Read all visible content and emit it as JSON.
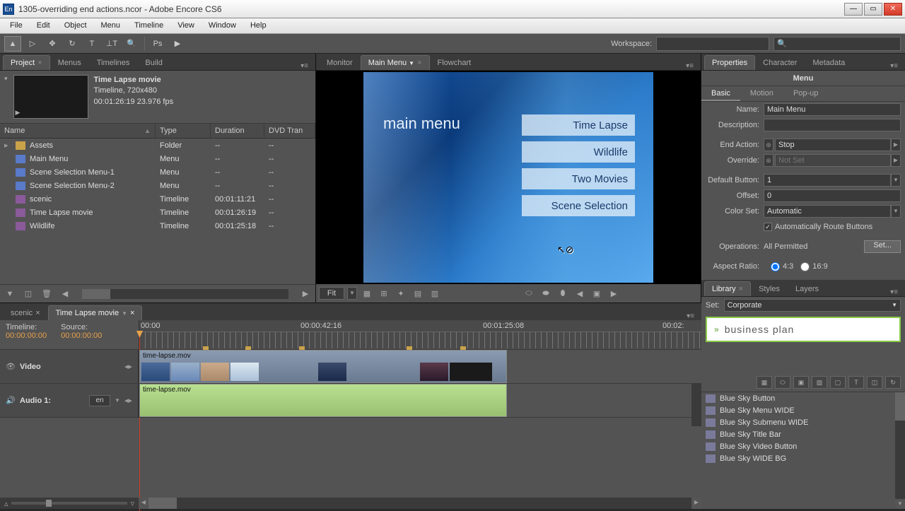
{
  "title": "1305-overriding end actions.ncor - Adobe Encore CS6",
  "menubar": [
    "File",
    "Edit",
    "Object",
    "Menu",
    "Timeline",
    "View",
    "Window",
    "Help"
  ],
  "workspace_label": "Workspace:",
  "project": {
    "tabs": [
      "Project",
      "Menus",
      "Timelines",
      "Build"
    ],
    "active_tab": 0,
    "info": {
      "name": "Time Lapse movie",
      "meta1": "Timeline, 720x480",
      "meta2": "00:01:26:19 23.976 fps"
    },
    "columns": [
      "Name",
      "Type",
      "Duration",
      "DVD Tran"
    ],
    "rows": [
      {
        "name": "Assets",
        "type": "Folder",
        "dur": "--",
        "trans": "--",
        "icon": "folder"
      },
      {
        "name": "Main Menu",
        "type": "Menu",
        "dur": "--",
        "trans": "--",
        "icon": "menu"
      },
      {
        "name": "Scene Selection Menu-1",
        "type": "Menu",
        "dur": "--",
        "trans": "--",
        "icon": "menu"
      },
      {
        "name": "Scene Selection Menu-2",
        "type": "Menu",
        "dur": "--",
        "trans": "--",
        "icon": "menu"
      },
      {
        "name": "scenic",
        "type": "Timeline",
        "dur": "00:01:11:21",
        "trans": "--",
        "icon": "tl"
      },
      {
        "name": "Time Lapse movie",
        "type": "Timeline",
        "dur": "00:01:26:19",
        "trans": "--",
        "icon": "tl"
      },
      {
        "name": "Wildlife",
        "type": "Timeline",
        "dur": "00:01:25:18",
        "trans": "--",
        "icon": "tl"
      }
    ]
  },
  "center_tabs": {
    "monitor": "Monitor",
    "main_menu": "Main Menu",
    "flowchart": "Flowchart"
  },
  "monitor": {
    "title": "main menu",
    "buttons": [
      "Time Lapse",
      "Wildlife",
      "Two Movies",
      "Scene Selection"
    ],
    "fit": "Fit"
  },
  "properties": {
    "tabs": [
      "Properties",
      "Character",
      "Metadata"
    ],
    "title": "Menu",
    "subtabs": [
      "Basic",
      "Motion",
      "Pop-up"
    ],
    "name_label": "Name:",
    "name": "Main Menu",
    "desc_label": "Description:",
    "desc": "",
    "endaction_label": "End Action:",
    "endaction": "Stop",
    "override_label": "Override:",
    "override": "Not Set",
    "defbtn_label": "Default Button:",
    "defbtn": "1",
    "offset_label": "Offset:",
    "offset": "0",
    "colorset_label": "Color Set:",
    "colorset": "Automatic",
    "autoroute": "Automatically Route Buttons",
    "ops_label": "Operations:",
    "ops": "All Permitted",
    "set_btn": "Set...",
    "aspect_label": "Aspect Ratio:",
    "aspect_43": "4:3",
    "aspect_169": "16:9"
  },
  "library": {
    "tabs": [
      "Library",
      "Styles",
      "Layers"
    ],
    "set_label": "Set:",
    "set": "Corporate",
    "preview_text": "business plan",
    "items": [
      "Blue Sky Button",
      "Blue Sky Menu WIDE",
      "Blue Sky Submenu WIDE",
      "Blue Sky Title Bar",
      "Blue Sky Video Button",
      "Blue Sky WIDE BG"
    ]
  },
  "timeline": {
    "tabs": [
      {
        "label": "scenic",
        "active": false
      },
      {
        "label": "Time Lapse movie",
        "active": true
      }
    ],
    "timeline_label": "Timeline:",
    "timeline_tc": "00:00:00:00",
    "source_label": "Source:",
    "source_tc": "00:00:00:00",
    "ruler": [
      "00:00",
      "00:00:42:16",
      "00:01:25:08",
      "00:02:"
    ],
    "video_label": "Video",
    "video_clip": "time-lapse.mov",
    "audio_label": "Audio 1:",
    "audio_lang": "en",
    "audio_clip": "time-lapse.mov"
  }
}
